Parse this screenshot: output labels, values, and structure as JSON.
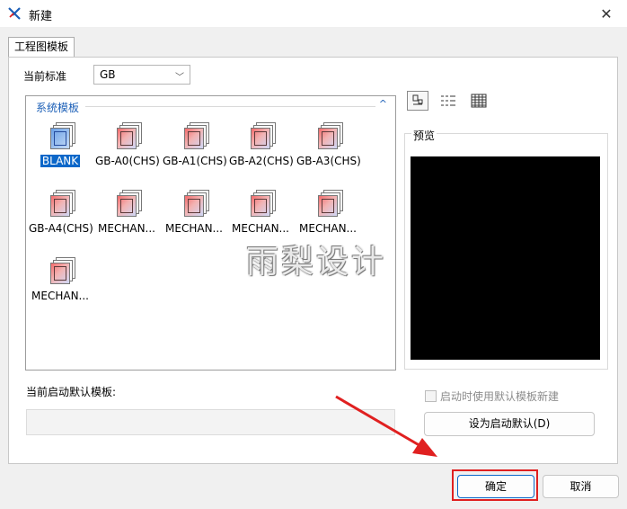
{
  "window": {
    "title": "新建",
    "close_glyph": "✕"
  },
  "tabs": [
    {
      "label": "工程图模板"
    }
  ],
  "standard": {
    "label": "当前标准",
    "value": "GB"
  },
  "gallery": {
    "group_title": "系统模板",
    "templates": [
      {
        "label": "BLANK",
        "selected": true
      },
      {
        "label": "GB-A0(CHS)"
      },
      {
        "label": "GB-A1(CHS)"
      },
      {
        "label": "GB-A2(CHS)"
      },
      {
        "label": "GB-A3(CHS)"
      },
      {
        "label": "GB-A4(CHS)"
      },
      {
        "label": "MECHAN..."
      },
      {
        "label": "MECHAN..."
      },
      {
        "label": "MECHAN..."
      },
      {
        "label": "MECHAN..."
      },
      {
        "label": "MECHAN..."
      }
    ]
  },
  "view_modes": [
    "large-icons-icon",
    "list-view-icon",
    "details-view-icon"
  ],
  "preview": {
    "label": "预览"
  },
  "default_template": {
    "label": "当前启动默认模板:",
    "value": ""
  },
  "startup_checkbox": {
    "label": "启动时使用默认模板新建",
    "checked": false,
    "disabled": true
  },
  "buttons": {
    "set_default": "设为启动默认(D)",
    "ok": "确定",
    "cancel": "取消"
  },
  "watermark": "雨梨设计",
  "colors": {
    "selection": "#0b67c9",
    "group_header": "#1b5fb7",
    "annotation_red": "#e02020"
  }
}
